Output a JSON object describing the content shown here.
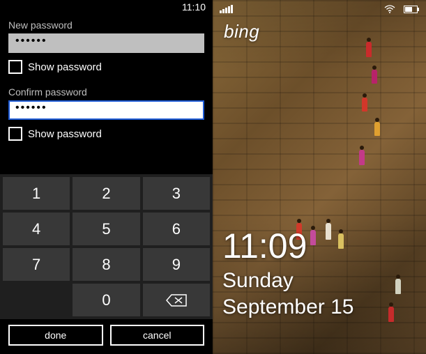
{
  "left_phone": {
    "status_time": "11:10",
    "new_password_label": "New password",
    "new_password_value": "••••••",
    "show_password_label_1": "Show password",
    "confirm_password_label": "Confirm password",
    "confirm_password_value": "••••••",
    "show_password_label_2": "Show password",
    "keypad": [
      "1",
      "2",
      "3",
      "4",
      "5",
      "6",
      "7",
      "8",
      "9"
    ],
    "key_zero": "0",
    "done_label": "done",
    "cancel_label": "cancel"
  },
  "right_phone": {
    "brand": "bing",
    "lock_time": "11:09",
    "lock_day": "Sunday",
    "lock_date": "September 15"
  }
}
